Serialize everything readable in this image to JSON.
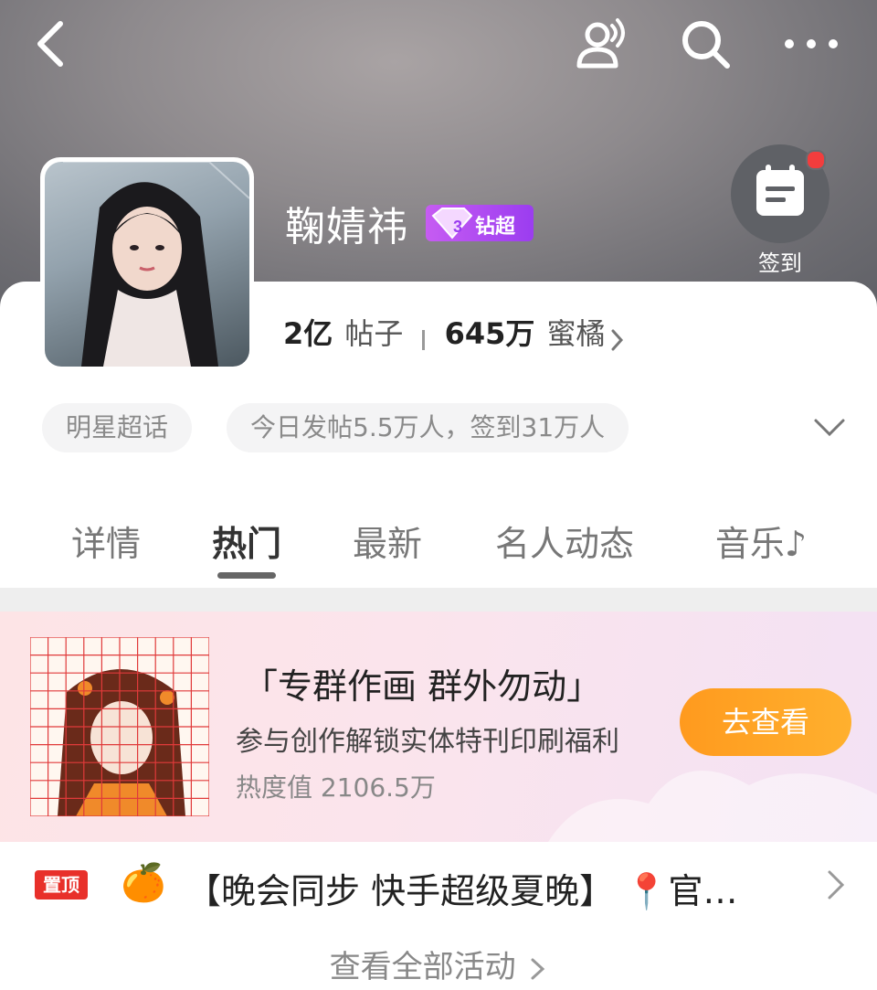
{
  "header": {
    "back_icon": "chevron-left-icon",
    "actions": [
      "people-icon",
      "search-icon",
      "more-icon"
    ]
  },
  "profile": {
    "name": "鞠婧祎",
    "badge": {
      "level": "3",
      "label": "钻超",
      "color": "#b14cf0"
    },
    "posts_value": "2亿",
    "posts_label": "帖子",
    "members_value": "645万",
    "members_label": "蜜橘"
  },
  "checkin": {
    "label": "签到"
  },
  "chips": {
    "category": "明星超话",
    "stats": "今日发帖5.5万人，签到31万人"
  },
  "tabs": [
    "详情",
    "热门",
    "最新",
    "名人动态",
    "音乐♪"
  ],
  "banner": {
    "title": "「专群作画 群外勿动」",
    "subtitle": "参与创作解锁实体特刊印刷福利",
    "heat": "热度值 2106.5万",
    "button": "去查看"
  },
  "pinned": {
    "badge": "置顶",
    "emoji": "🍊",
    "text": "【晚会同步 快手超级夏晚】 📍官…"
  },
  "footer": {
    "all_activity": "查看全部活动"
  },
  "colors": {
    "accent_orange": "#ffa526",
    "pin_red": "#e8302a",
    "badge_purple": "#b14cf0"
  }
}
